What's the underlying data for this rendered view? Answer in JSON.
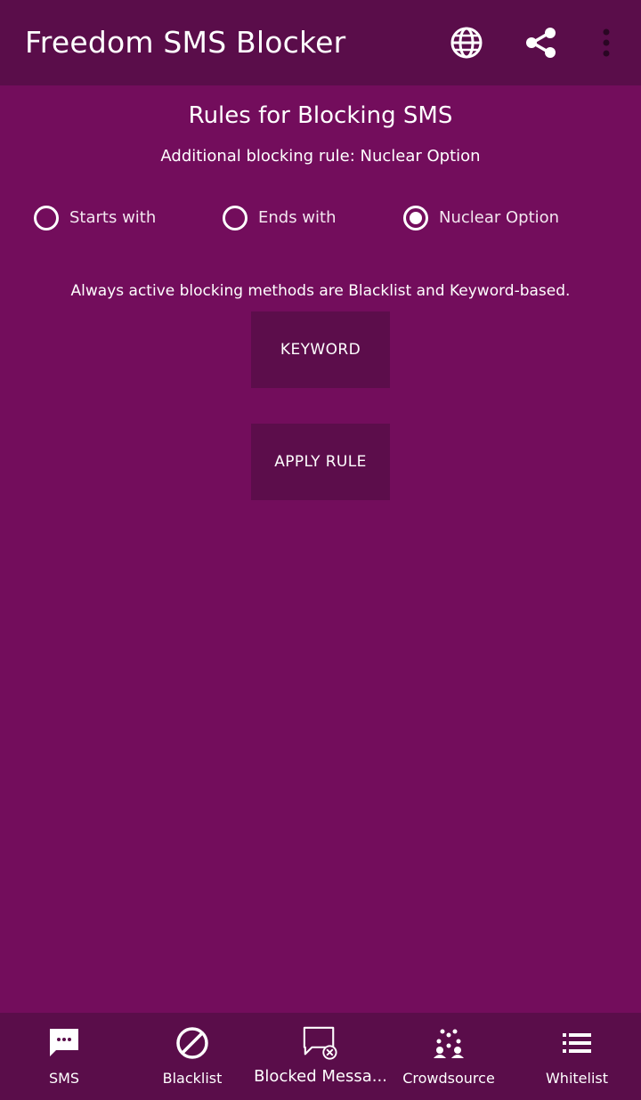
{
  "appbar": {
    "title": "Freedom SMS Blocker",
    "actions": [
      {
        "name": "language",
        "icon": "globe-icon"
      },
      {
        "name": "share",
        "icon": "share-icon"
      },
      {
        "name": "more",
        "icon": "more-vert-icon"
      }
    ]
  },
  "main": {
    "title": "Rules for Blocking SMS",
    "additional_rule": "Additional blocking rule: Nuclear Option",
    "rule_options": [
      {
        "label": "Starts with",
        "selected": false
      },
      {
        "label": "Ends with",
        "selected": false
      },
      {
        "label": "Nuclear Option",
        "selected": true
      }
    ],
    "info": "Always active blocking methods are Blacklist and Keyword-based.",
    "keyword_button": "KEYWORD",
    "apply_button": "APPLY RULE"
  },
  "bottom_nav": {
    "items": [
      {
        "label": "SMS",
        "icon": "sms-icon"
      },
      {
        "label": "Blacklist",
        "icon": "block-icon"
      },
      {
        "label": "Blocked Messa...",
        "icon": "blocked-message-icon"
      },
      {
        "label": "Crowdsource",
        "icon": "crowdsource-icon"
      },
      {
        "label": "Whitelist",
        "icon": "list-icon"
      }
    ]
  },
  "colors": {
    "background": "#730d5c",
    "appbar": "#5a0d4a",
    "button": "#5c0d4b",
    "text": "#ffffff"
  }
}
